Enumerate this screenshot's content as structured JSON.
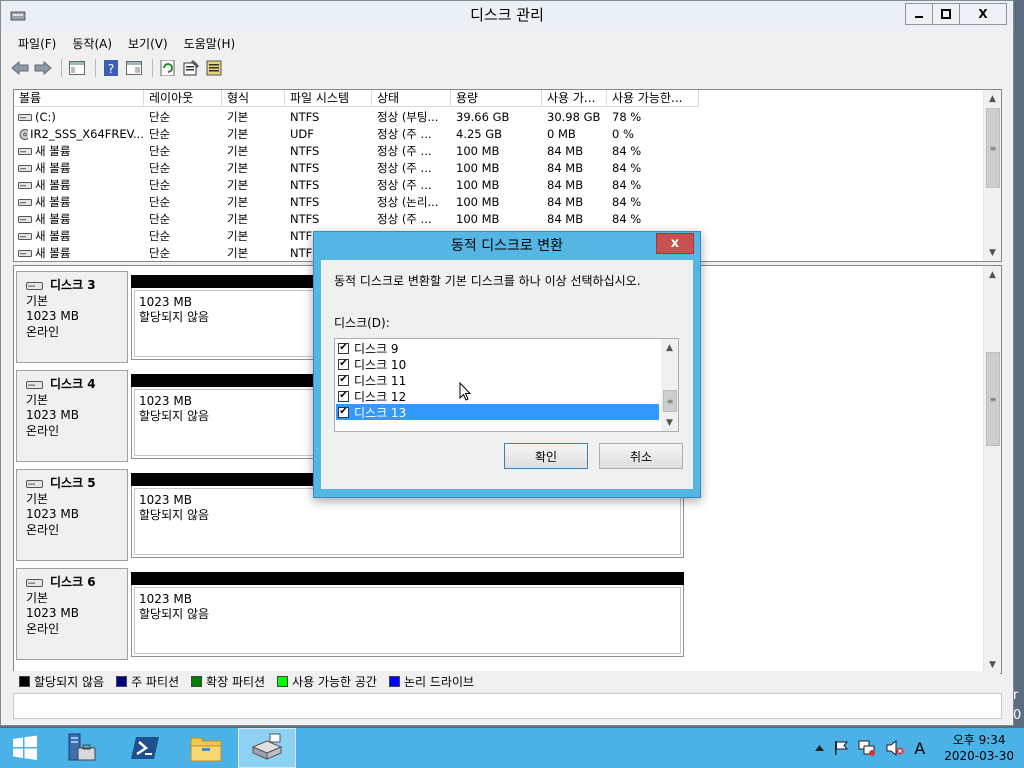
{
  "window": {
    "title": "디스크 관리",
    "min_label": "",
    "max_label": "",
    "close_label": "X"
  },
  "menu": [
    "파일(F)",
    "동작(A)",
    "보기(V)",
    "도움말(H)"
  ],
  "volume_list": {
    "columns": [
      "볼륨",
      "레이아웃",
      "형식",
      "파일 시스템",
      "상태",
      "용량",
      "사용 가...",
      "사용 가능한..."
    ],
    "rows": [
      {
        "volume": "(C:)",
        "layout": "단순",
        "type": "기본",
        "fs": "NTFS",
        "status": "정상 (부팅...",
        "capacity": "39.66 GB",
        "free": "30.98 GB",
        "pct": "78 %"
      },
      {
        "volume": "IR2_SSS_X64FREV...",
        "layout": "단순",
        "type": "기본",
        "fs": "UDF",
        "status": "정상 (주 ...",
        "capacity": "4.25 GB",
        "free": "0 MB",
        "pct": "0 %"
      },
      {
        "volume": "새 볼륨",
        "layout": "단순",
        "type": "기본",
        "fs": "NTFS",
        "status": "정상 (주 ...",
        "capacity": "100 MB",
        "free": "84 MB",
        "pct": "84 %"
      },
      {
        "volume": "새 볼륨",
        "layout": "단순",
        "type": "기본",
        "fs": "NTFS",
        "status": "정상 (주 ...",
        "capacity": "100 MB",
        "free": "84 MB",
        "pct": "84 %"
      },
      {
        "volume": "새 볼륨",
        "layout": "단순",
        "type": "기본",
        "fs": "NTFS",
        "status": "정상 (주 ...",
        "capacity": "100 MB",
        "free": "84 MB",
        "pct": "84 %"
      },
      {
        "volume": "새 볼륨",
        "layout": "단순",
        "type": "기본",
        "fs": "NTFS",
        "status": "정상 (논리...",
        "capacity": "100 MB",
        "free": "84 MB",
        "pct": "84 %"
      },
      {
        "volume": "새 볼륨",
        "layout": "단순",
        "type": "기본",
        "fs": "NTFS",
        "status": "정상 (주 ...",
        "capacity": "100 MB",
        "free": "84 MB",
        "pct": "84 %"
      },
      {
        "volume": "새 볼륨",
        "layout": "단순",
        "type": "기본",
        "fs": "NTF",
        "status": "",
        "capacity": "",
        "free": "",
        "pct": ""
      },
      {
        "volume": "새 볼륨",
        "layout": "단순",
        "type": "기본",
        "fs": "NTF",
        "status": "",
        "capacity": "",
        "free": "",
        "pct": ""
      }
    ]
  },
  "disks": [
    {
      "name": "디스크 3",
      "kind": "기본",
      "size": "1023 MB",
      "state": "온라인",
      "part_size": "1023 MB",
      "part_state": "할당되지 않음"
    },
    {
      "name": "디스크 4",
      "kind": "기본",
      "size": "1023 MB",
      "state": "온라인",
      "part_size": "1023 MB",
      "part_state": "할당되지 않음"
    },
    {
      "name": "디스크 5",
      "kind": "기본",
      "size": "1023 MB",
      "state": "온라인",
      "part_size": "1023 MB",
      "part_state": "할당되지 않음"
    },
    {
      "name": "디스크 6",
      "kind": "기본",
      "size": "1023 MB",
      "state": "온라인",
      "part_size": "1023 MB",
      "part_state": "할당되지 않음"
    }
  ],
  "legend": [
    {
      "label": "할당되지 않음",
      "color": "#000000"
    },
    {
      "label": "주 파티션",
      "color": "#000080"
    },
    {
      "label": "확장 파티션",
      "color": "#008000"
    },
    {
      "label": "사용 가능한 공간",
      "color": "#00ff00"
    },
    {
      "label": "논리 드라이브",
      "color": "#0000ff"
    }
  ],
  "dialog": {
    "title": "동적 디스크로 변환",
    "close_label": "x",
    "message": "동적 디스크로 변환할 기본 디스크를 하나 이상 선택하십시오.",
    "list_label": "디스크(D):",
    "items": [
      {
        "label": "디스크 9",
        "checked": true,
        "selected": false
      },
      {
        "label": "디스크 10",
        "checked": true,
        "selected": false
      },
      {
        "label": "디스크 11",
        "checked": true,
        "selected": false
      },
      {
        "label": "디스크 12",
        "checked": true,
        "selected": false
      },
      {
        "label": "디스크 13",
        "checked": true,
        "selected": true
      }
    ],
    "ok_label": "확인",
    "cancel_label": "취소"
  },
  "desktop": {
    "edge_text_1": "r",
    "edge_text_2": "0"
  },
  "taskbar": {
    "apps": [
      "start-icon",
      "server-manager-icon",
      "powershell-icon",
      "file-explorer-icon",
      "disk-management-icon"
    ],
    "tray_ime": "A",
    "clock_time": "오후 9:34",
    "clock_date": "2020-03-30"
  },
  "colors": {
    "accent": "#4ab2e6",
    "dialog_frame": "#55b6e4",
    "selection": "#3399ff",
    "close_red": "#c75050"
  }
}
